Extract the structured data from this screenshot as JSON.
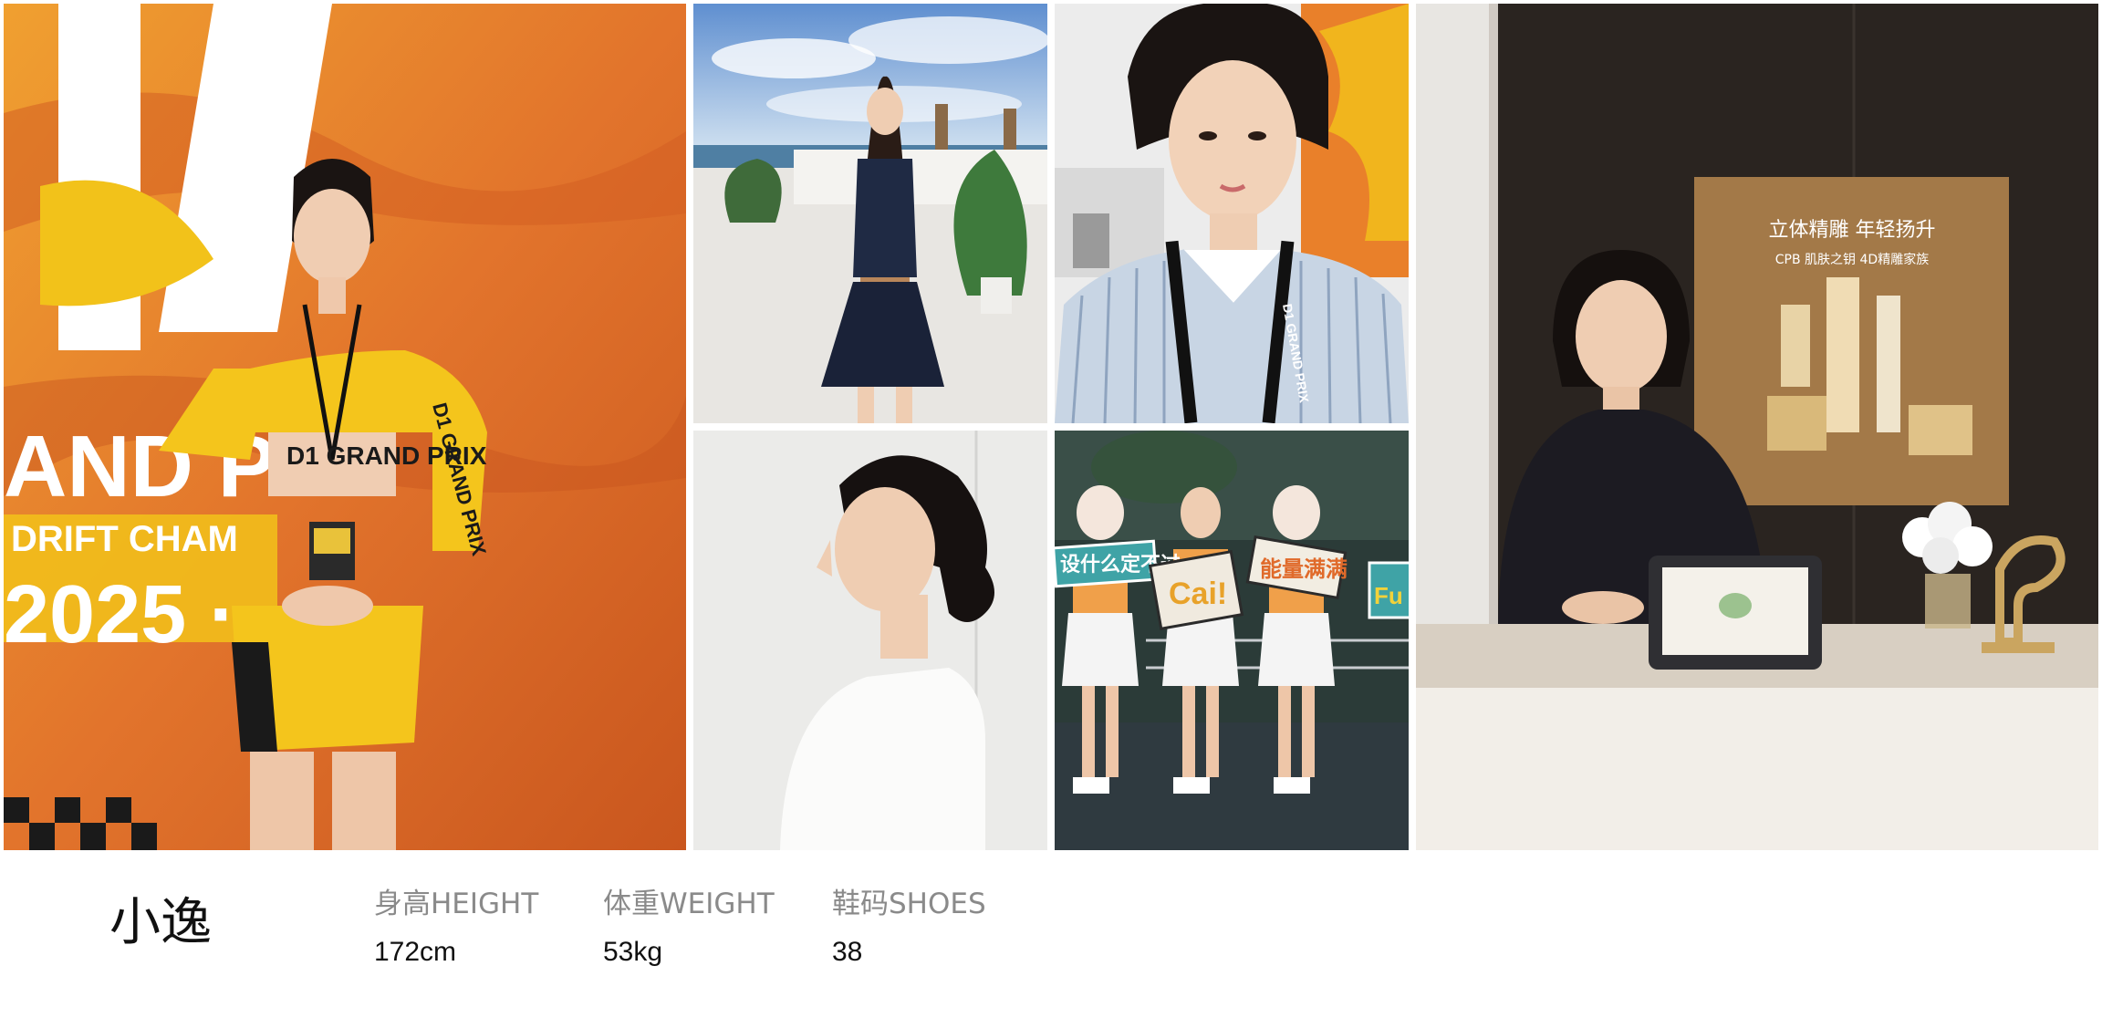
{
  "photos": [
    {
      "id": "racing-event",
      "text": [
        "AND P",
        "DRIFT CHAM",
        "2025 ·",
        "D1 GRAND PRIX",
        "D1 GRAND PRIX"
      ]
    },
    {
      "id": "terrace-dress"
    },
    {
      "id": "striped-shirt-selfie",
      "text": [
        "D1 GRAND PRIX"
      ]
    },
    {
      "id": "profile-white-top"
    },
    {
      "id": "cheer-group",
      "text": [
        "设什么定不过",
        "Cai!",
        "能量满满",
        "Fu"
      ]
    },
    {
      "id": "cosmetics-counter",
      "text": [
        "立体精雕 年轻扬升",
        "CPB 肌肤之钥 4D精雕家族"
      ]
    }
  ],
  "model": {
    "name": "小逸",
    "stats": [
      {
        "label": "身高HEIGHT",
        "value": "172cm"
      },
      {
        "label": "体重WEIGHT",
        "value": "53kg"
      },
      {
        "label": "鞋码SHOES",
        "value": "38"
      }
    ]
  },
  "colors": {
    "banner_orange": "#e2742c",
    "banner_yellow": "#f2c21a",
    "uniform_yellow": "#f4c51c",
    "sky_blue": "#7fa7d6",
    "navy_dress": "#1f2a44",
    "stripe_blue": "#b9c8da",
    "night_bg": "#2b3b38",
    "cheer_orange": "#f0a04a",
    "wall_dark": "#2a2420",
    "poster_gold": "#b88c55",
    "label_gray": "#8a8a8a",
    "text_dark": "#111111"
  }
}
